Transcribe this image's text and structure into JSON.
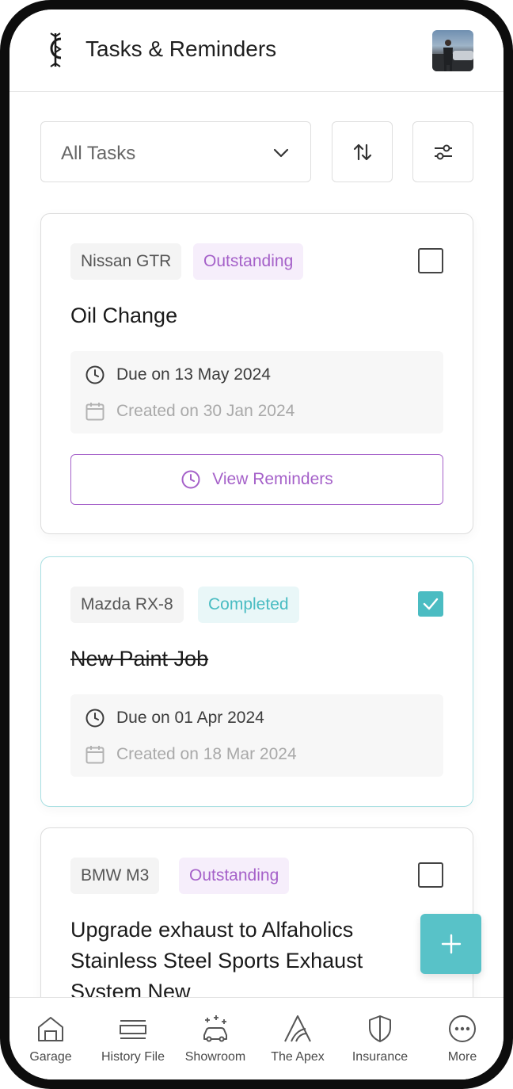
{
  "header": {
    "title": "Tasks & Reminders"
  },
  "filter": {
    "selected": "All Tasks"
  },
  "tasks": [
    {
      "car": "Nissan GTR",
      "status": "Outstanding",
      "title": "Oil Change",
      "due": "Due on 13 May 2024",
      "created": "Created on 30 Jan 2024",
      "checked": false,
      "action_label": "View Reminders"
    },
    {
      "car": "Mazda RX-8",
      "status": "Completed",
      "title": "New Paint Job",
      "due": "Due on 01 Apr 2024",
      "created": "Created on 18 Mar 2024",
      "checked": true
    },
    {
      "car": "BMW M3",
      "status": "Outstanding",
      "title_lines": [
        "Upgrade exhaust to Alfaholics",
        "Stainless Steel Sports Exhaust",
        "System New"
      ],
      "checked": false
    }
  ],
  "colors": {
    "accent_purple": "#a561c9",
    "accent_teal": "#4bbcc2",
    "outstanding_bg": "#f6eefb",
    "completed_bg": "#e9f7f8"
  },
  "bottom_nav": {
    "items": [
      {
        "label": "Garage",
        "icon": "garage-icon"
      },
      {
        "label": "History File",
        "icon": "history-file-icon"
      },
      {
        "label": "Showroom",
        "icon": "showroom-icon"
      },
      {
        "label": "The Apex",
        "icon": "apex-icon"
      },
      {
        "label": "Insurance",
        "icon": "shield-icon"
      },
      {
        "label": "More",
        "icon": "more-icon"
      }
    ]
  }
}
